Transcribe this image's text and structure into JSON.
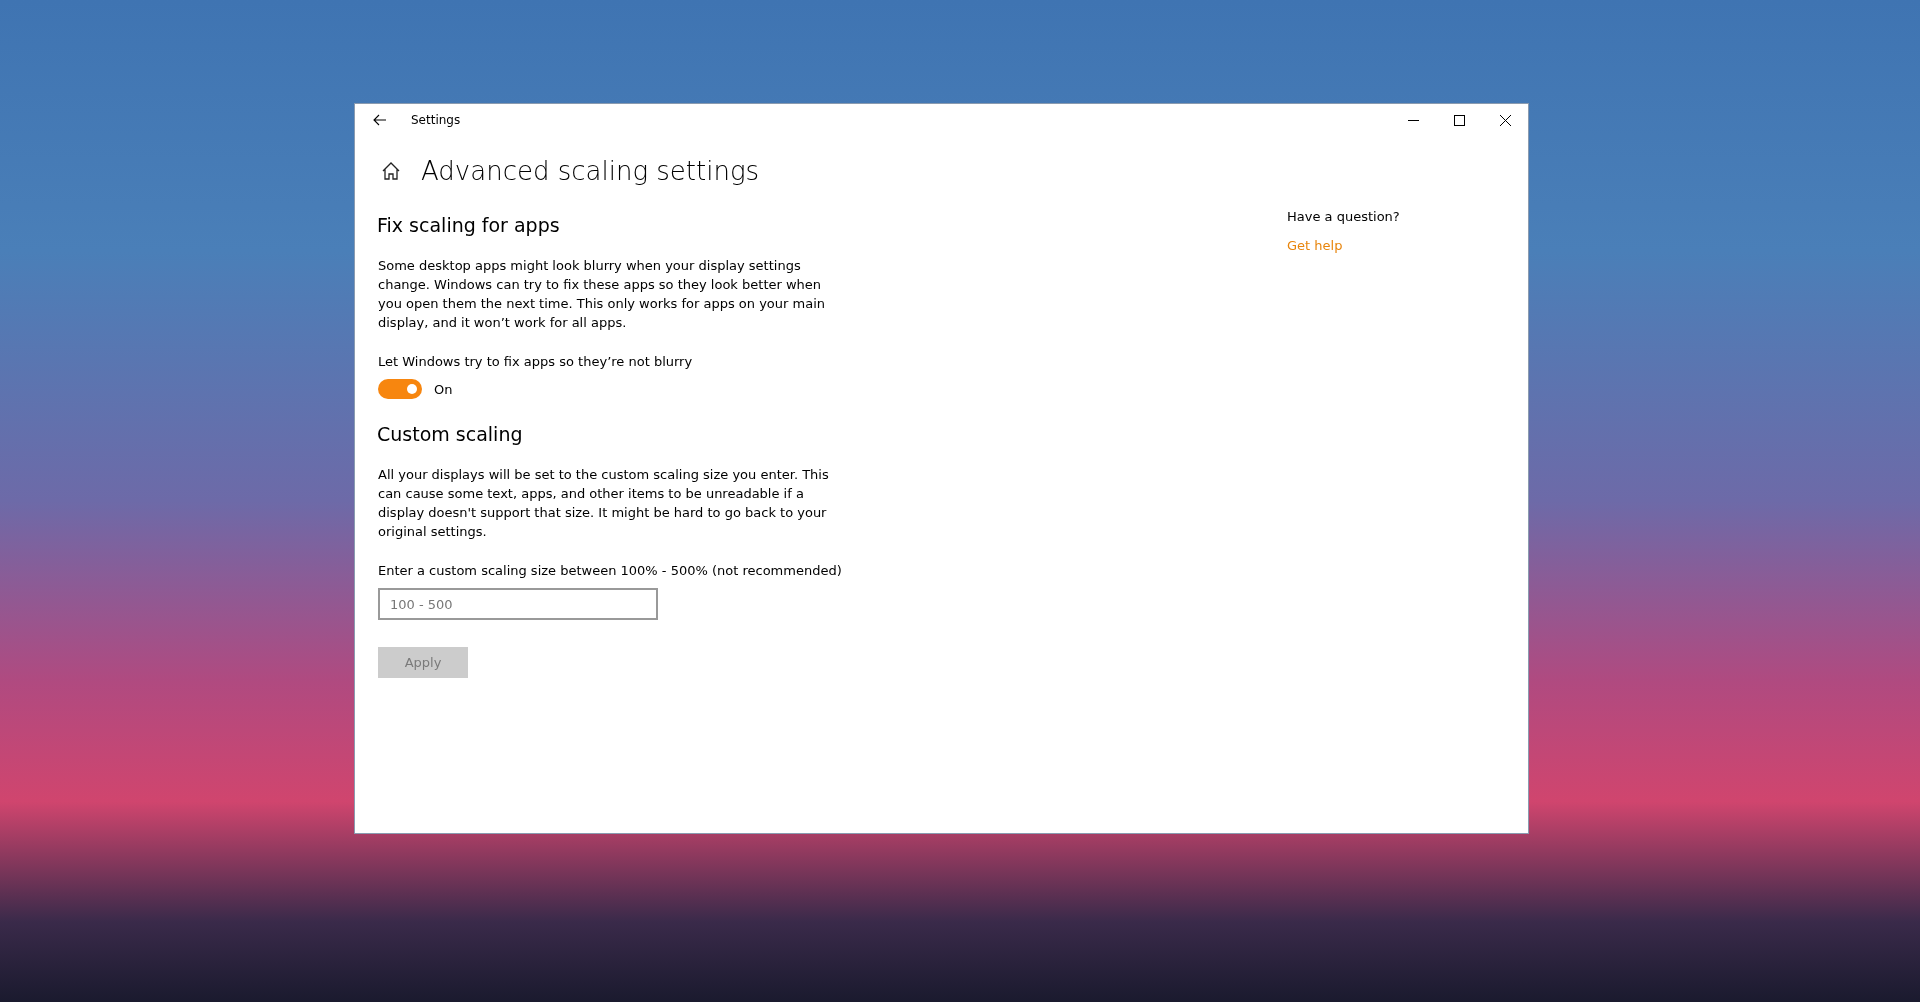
{
  "window": {
    "title": "Settings"
  },
  "page_title": "Advanced scaling settings",
  "sections": [
    {
      "kind": "toggle",
      "heading": "Fix scaling for apps",
      "description": "Some desktop apps might look blurry when your display settings change. Windows can try to fix these apps so they look better when you open them the next time. This only works for apps on your main display, and it won’t work for all apps.",
      "label": "Let Windows try to fix apps so they’re not blurry",
      "on": true,
      "state_text": "On"
    },
    {
      "kind": "input",
      "heading": "Custom scaling",
      "description": "All your displays will be set to the custom scaling size you enter. This can cause some text, apps, and other items to be unreadable if a display doesn't support that size. It might be hard to go back to your original settings.",
      "label": "Enter a custom scaling size between 100% - 500% (not recommended)",
      "placeholder": "100 - 500",
      "button": {
        "label": "Apply",
        "disabled": true
      }
    }
  ],
  "help": {
    "question": "Have a question?",
    "link": "Get help"
  }
}
